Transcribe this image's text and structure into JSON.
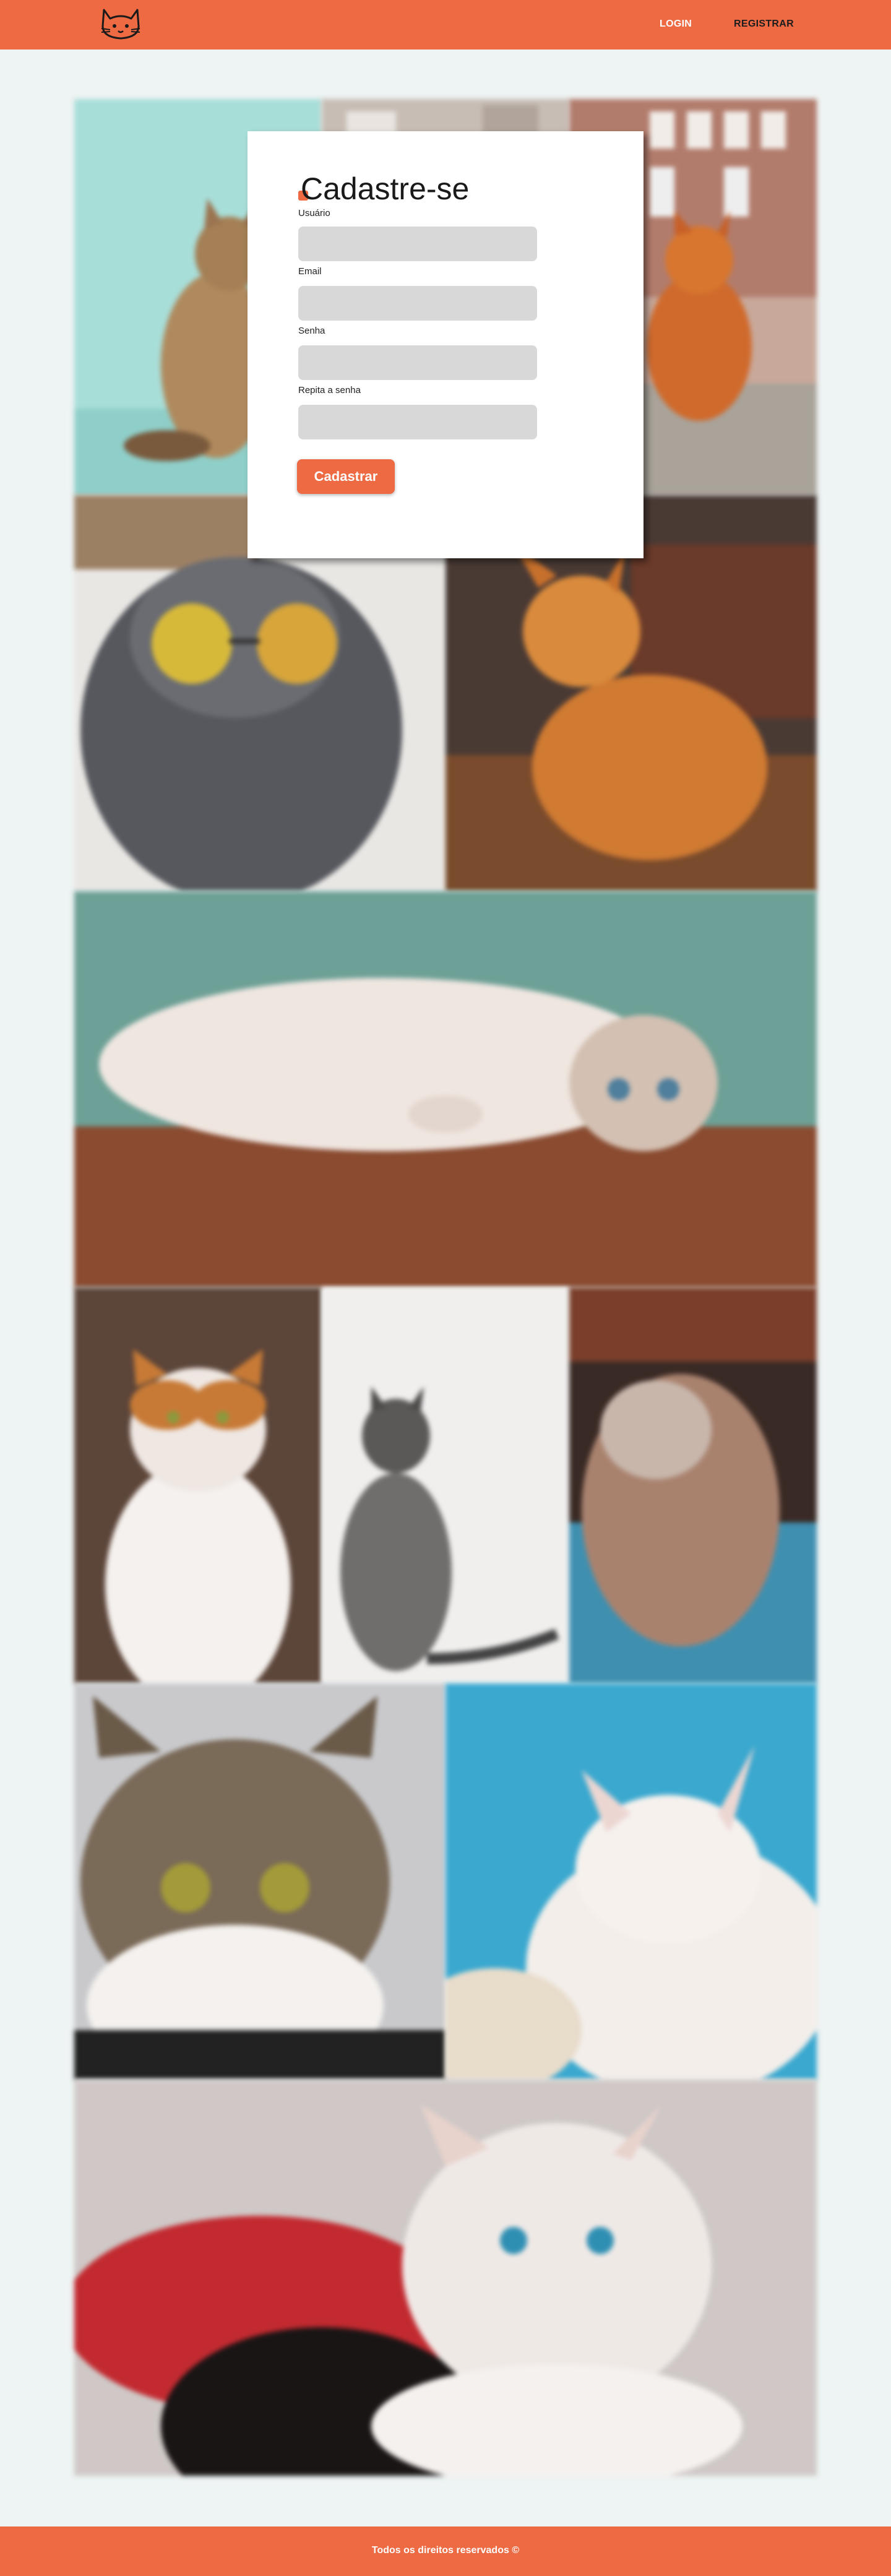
{
  "header": {
    "logo_icon": "cat-face-icon",
    "nav": {
      "login_label": "LOGIN",
      "register_label": "REGISTRAR"
    },
    "colors": {
      "background": "#ed6a43",
      "login_text": "#ffffff",
      "register_text": "#1d1d1d"
    }
  },
  "register_form": {
    "title": "Cadastre-se",
    "fields": [
      {
        "label": "Usuário",
        "value": "",
        "placeholder": ""
      },
      {
        "label": "Email",
        "value": "",
        "placeholder": ""
      },
      {
        "label": "Senha",
        "value": "",
        "placeholder": ""
      },
      {
        "label": "Repita a senha",
        "value": "",
        "placeholder": ""
      }
    ],
    "submit_label": "Cadastrar"
  },
  "gallery": {
    "images": [
      {
        "icon": "cat-photo",
        "description_icon": "cat-on-teal-background"
      },
      {
        "icon": "cat-photo",
        "description_icon": "ginger-cat-on-street"
      },
      {
        "icon": "cat-photo",
        "description_icon": "grey-cat-with-sunglasses"
      },
      {
        "icon": "cat-photo",
        "description_icon": "ginger-cat-on-table"
      },
      {
        "icon": "cat-photo",
        "description_icon": "cat-lying-on-floor"
      },
      {
        "icon": "cat-photo",
        "description_icon": "orange-white-cat"
      },
      {
        "icon": "cat-photo",
        "description_icon": "grey-tabby-sitting"
      },
      {
        "icon": "cat-photo",
        "description_icon": "fluffy-cat-blue-background"
      },
      {
        "icon": "cat-photo",
        "description_icon": "tabby-cat-closeup"
      },
      {
        "icon": "cat-photo",
        "description_icon": "white-cat-on-blue"
      },
      {
        "icon": "cat-photo",
        "description_icon": "two-kittens"
      }
    ]
  },
  "footer": {
    "text": "Todos os direitos reservados ©"
  }
}
